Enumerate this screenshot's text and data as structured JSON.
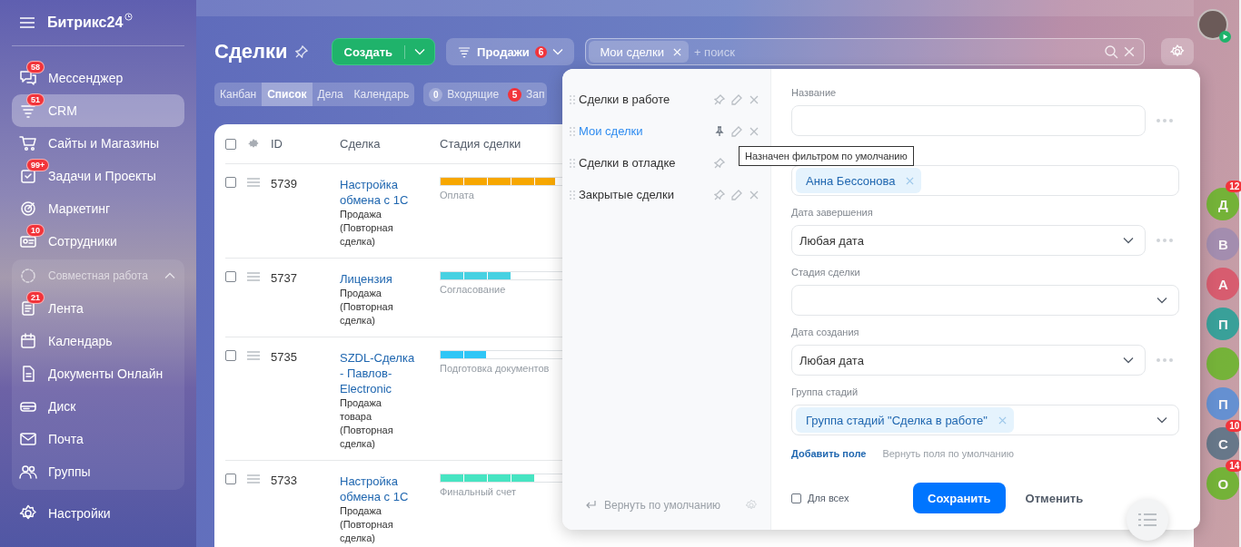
{
  "sidebar": {
    "logo": "Битрикс24",
    "items": [
      {
        "label": "Мессенджер",
        "badge": "58",
        "selected": false
      },
      {
        "label": "CRM",
        "badge": "51",
        "selected": true
      },
      {
        "label": "Сайты и Магазины",
        "selected": false
      },
      {
        "label": "Задачи и Проекты",
        "badge": "99+",
        "selected": false
      },
      {
        "label": "Маркетинг",
        "selected": false
      },
      {
        "label": "Сотрудники",
        "badge": "10",
        "selected": false
      }
    ],
    "group": {
      "label": "Совместная работа",
      "expanded": true,
      "items": [
        {
          "label": "Лента",
          "badge": "21",
          "selected": false
        },
        {
          "label": "Календарь",
          "selected": false
        },
        {
          "label": "Документы Онлайн",
          "selected": false
        },
        {
          "label": "Диск",
          "selected": false
        },
        {
          "label": "Почта",
          "selected": false
        },
        {
          "label": "Группы",
          "selected": false
        }
      ]
    },
    "footer": "Настройки"
  },
  "header": {
    "title": "Сделки",
    "create_button": "Создать",
    "category_button": {
      "label": "Продажи",
      "badge": "6"
    },
    "search": {
      "chips": [
        "Мои сделки"
      ],
      "placeholder": "+ поиск"
    }
  },
  "views": [
    {
      "label": "Канбан",
      "selected": false
    },
    {
      "label": "Список",
      "selected": true
    },
    {
      "label": "Дела",
      "selected": false
    },
    {
      "label": "Календарь",
      "selected": false
    }
  ],
  "counters": [
    {
      "count": "0",
      "label": "Входящие",
      "kind": "zero"
    },
    {
      "count": "5",
      "label": "Зап",
      "kind": "alert"
    }
  ],
  "table": {
    "all_checked": false,
    "columns": [
      "ID",
      "Сделка",
      "Стадия сделки"
    ],
    "rows": [
      {
        "checked": false,
        "id": "5739",
        "title": "Настройка обмена с 1С",
        "type": "Продажа (Повторная сделка)",
        "stage": "Оплата",
        "level": 0.7,
        "color": "#f7a700"
      },
      {
        "checked": false,
        "id": "5737",
        "title": "Лицензия",
        "type": "Продажа (Повторная сделка)",
        "stage": "Согласование",
        "level": 0.43,
        "color": "#47d1e2"
      },
      {
        "checked": false,
        "id": "5735",
        "title": "SZDL-Сделка - Павлов-Electronic",
        "type": "Продажа товара (Повторная сделка)",
        "stage": "Подготовка документов",
        "level": 0.28,
        "color": "#2fc6f6"
      },
      {
        "checked": false,
        "id": "5733",
        "title": "Настройка обмена с 1С",
        "type": "Продажа (Повторная сделка)",
        "stage": "Финальный счет",
        "level": 0.57,
        "color": "#47e4c2"
      }
    ]
  },
  "filter_popup": {
    "presets": [
      {
        "label": "Сделки в работе",
        "selected": false,
        "pinned": false,
        "editable": true
      },
      {
        "label": "Мои сделки",
        "selected": true,
        "pinned": true,
        "editable": true
      },
      {
        "label": "Сделки в отладке",
        "selected": false,
        "pinned": false,
        "editable": false
      },
      {
        "label": "Закрытые сделки",
        "selected": false,
        "pinned": false,
        "editable": true
      }
    ],
    "reset": "Вернуть по умолчанию",
    "tooltip": "Назначен фильтром по умолчанию",
    "fields": [
      {
        "label": "Название",
        "kind": "input",
        "more": true
      },
      {
        "kind": "tags",
        "chips": [
          "Анна Бессонова"
        ],
        "more": false
      },
      {
        "label": "Дата завершения",
        "kind": "select",
        "value": "Любая дата",
        "more": true
      },
      {
        "label": "Стадия сделки",
        "kind": "select",
        "more": false
      },
      {
        "label": "Дата создания",
        "kind": "select",
        "value": "Любая дата",
        "more": true
      },
      {
        "label": "Группа стадий",
        "kind": "select",
        "chips": [
          "Группа стадий \"Сделка в работе\""
        ],
        "more": false
      }
    ],
    "add_field": "Добавить поле",
    "restore_fields": "Вернуть поля по умолчанию",
    "for_all": {
      "label": "Для всех",
      "checked": false
    },
    "save": "Сохранить",
    "cancel": "Отменить"
  },
  "chats": [
    {
      "letter": "Д",
      "count": "12",
      "color": "#6cb52d"
    },
    {
      "letter": "В",
      "color": "#a08cb0"
    },
    {
      "letter": "А",
      "color": "#d9566a"
    },
    {
      "letter": "П",
      "color": "#2aa198"
    },
    {
      "color": "#6cb52d"
    },
    {
      "letter": "П",
      "color": "#5b8fd6"
    },
    {
      "letter": "С",
      "count": "10",
      "color": "#5d7386"
    },
    {
      "letter": "О",
      "count": "14",
      "color": "#6cb52d"
    }
  ]
}
